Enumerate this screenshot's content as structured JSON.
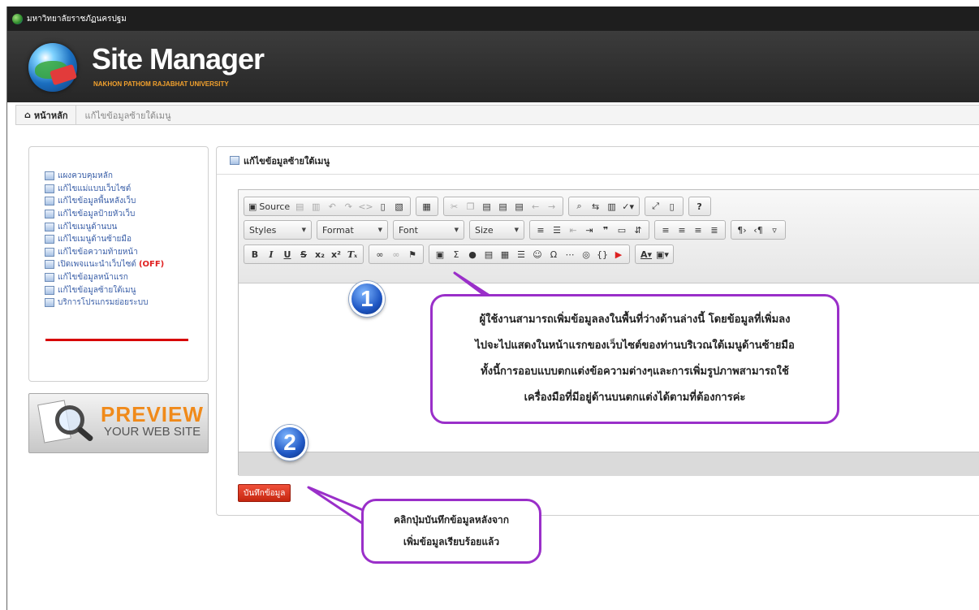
{
  "topbar": {
    "university": "มหาวิทยาลัยราชภัฏนครปฐม"
  },
  "header": {
    "title": "Site Manager",
    "subtitle": "NAKHON PATHOM RAJABHAT UNIVERSITY"
  },
  "breadcrumb": {
    "home": "หน้าหลัก",
    "current": "แก้ไขข้อมูลซ้ายใต้เมนู"
  },
  "sidebar": {
    "items": [
      {
        "label": "แผงควบคุมหลัก"
      },
      {
        "label": "แก้ไขแม่แบบเว็บไซต์"
      },
      {
        "label": "แก้ไขข้อมูลพื้นหลังเว็บ"
      },
      {
        "label": "แก้ไขข้อมูลป้ายหัวเว็บ"
      },
      {
        "label": "แก้ไขเมนูด้านบน"
      },
      {
        "label": "แก้ไขเมนูด้านซ้ายมือ"
      },
      {
        "label": "แก้ไขข้อความท้ายหน้า"
      },
      {
        "label": "เปิดเพจแนะนำเว็บไซต์",
        "badge": "(OFF)"
      },
      {
        "label": "แก้ไขข้อมูลหน้าแรก"
      },
      {
        "label": "แก้ไขข้อมูลซ้ายใต้เมนู"
      },
      {
        "label": "บริการโปรแกรมย่อยระบบ"
      }
    ]
  },
  "preview": {
    "line1": "PREVIEW",
    "line2": "YOUR WEB SITE"
  },
  "panel": {
    "title": "แก้ไขข้อมูลซ้ายใต้เมนู"
  },
  "editor": {
    "source_label": "Source",
    "styles_label": "Styles",
    "format_label": "Format",
    "font_label": "Font",
    "size_label": "Size"
  },
  "save_button": "บันทึกข้อมูล",
  "annotations": {
    "badge1": "1",
    "badge2": "2",
    "callout1": [
      "ผู้ใช้งานสามารถเพิ่มข้อมูลลงในพื้นที่ว่างด้านล่างนี้ โดยข้อมูลที่เพิ่มลง",
      "ไปจะไปแสดงในหน้าแรกของเว็บไซต์ของท่านบริเวณใต้เมนูด้านซ้ายมือ",
      "ทั้งนี้การออบแบบตกแต่งข้อความต่างๆและการเพิ่มรูปภาพสามารถใช้",
      "เครื่องมือที่มีอยู่ด้านบนตกแต่งได้ตามที่ต้องการค่ะ"
    ],
    "callout2": [
      "คลิกปุ่มบันทึกข้อมูลหลังจาก",
      "เพิ่มข้อมูลเรียบร้อยแล้ว"
    ]
  }
}
